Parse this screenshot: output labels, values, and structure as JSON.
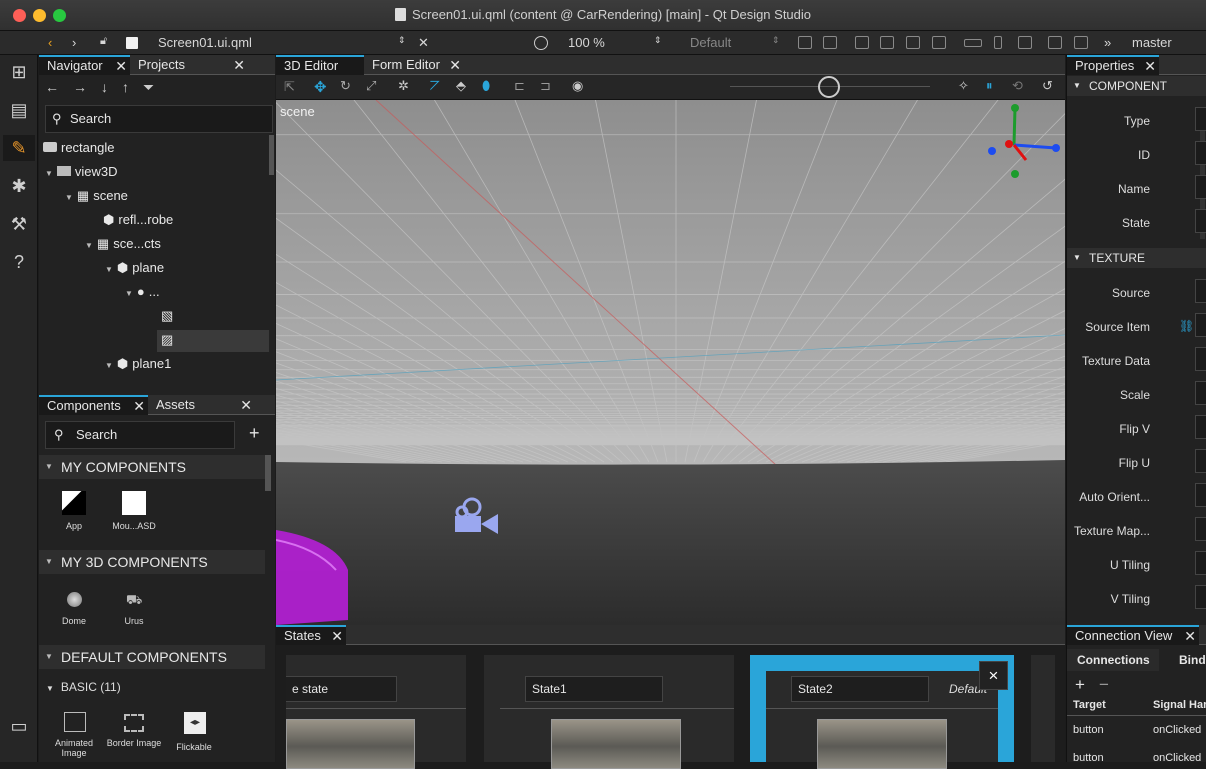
{
  "window": {
    "title": "Screen01.ui.qml (content @ CarRendering) [main] - Qt Design Studio"
  },
  "toolbar": {
    "file": "Screen01.ui.qml",
    "zoom": "100 %",
    "state": "Default",
    "branch": "master"
  },
  "navigator": {
    "tabs": [
      "Navigator",
      "Projects"
    ],
    "search_placeholder": "Search",
    "nodes": [
      {
        "label": "rectangle",
        "depth": 0
      },
      {
        "label": "view3D",
        "depth": 1
      },
      {
        "label": "scene",
        "depth": 2
      },
      {
        "label": "refl...robe",
        "depth": 3
      },
      {
        "label": "sce...cts",
        "depth": 3
      },
      {
        "label": "plane",
        "depth": 4
      },
      {
        "label": "...",
        "depth": 5
      },
      {
        "label": "plane1",
        "depth": 4
      }
    ]
  },
  "components": {
    "tabs": [
      "Components",
      "Assets"
    ],
    "search_placeholder": "Search",
    "sections": {
      "my": "MY COMPONENTS",
      "my3d": "MY 3D COMPONENTS",
      "default": "DEFAULT COMPONENTS"
    },
    "basic_label": "BASIC (11)",
    "my_items": [
      "App",
      "Mou...ASD"
    ],
    "my3d_items": [
      "Dome",
      "Urus"
    ],
    "basic_items": [
      "Animated Image",
      "Border Image",
      "Flickable"
    ]
  },
  "editor": {
    "tabs": [
      "3D Editor",
      "Form Editor"
    ],
    "scene_label": "scene"
  },
  "properties": {
    "tab": "Properties",
    "component_section": "COMPONENT",
    "component_fields": [
      "Type",
      "ID",
      "Name",
      "State"
    ],
    "texture_section": "TEXTURE",
    "texture_fields": [
      "Source",
      "Source Item",
      "Texture Data",
      "Scale",
      "Flip V",
      "Flip U",
      "Auto Orient...",
      "Texture Map...",
      "U Tiling",
      "V Tiling"
    ]
  },
  "states": {
    "tab": "States",
    "items": [
      "e state",
      "State1",
      "State2"
    ],
    "default_badge": "Default",
    "close": "×"
  },
  "connections": {
    "tab": "Connection View",
    "subtabs": [
      "Connections",
      "Bindi"
    ],
    "columns": [
      "Target",
      "Signal Har"
    ],
    "rows": [
      [
        "button",
        "onClicked"
      ],
      [
        "button",
        "onClicked"
      ]
    ]
  },
  "colors": {
    "accent": "#2aa5d9",
    "car": "#b020d0",
    "camera": "#9aa7ef"
  }
}
